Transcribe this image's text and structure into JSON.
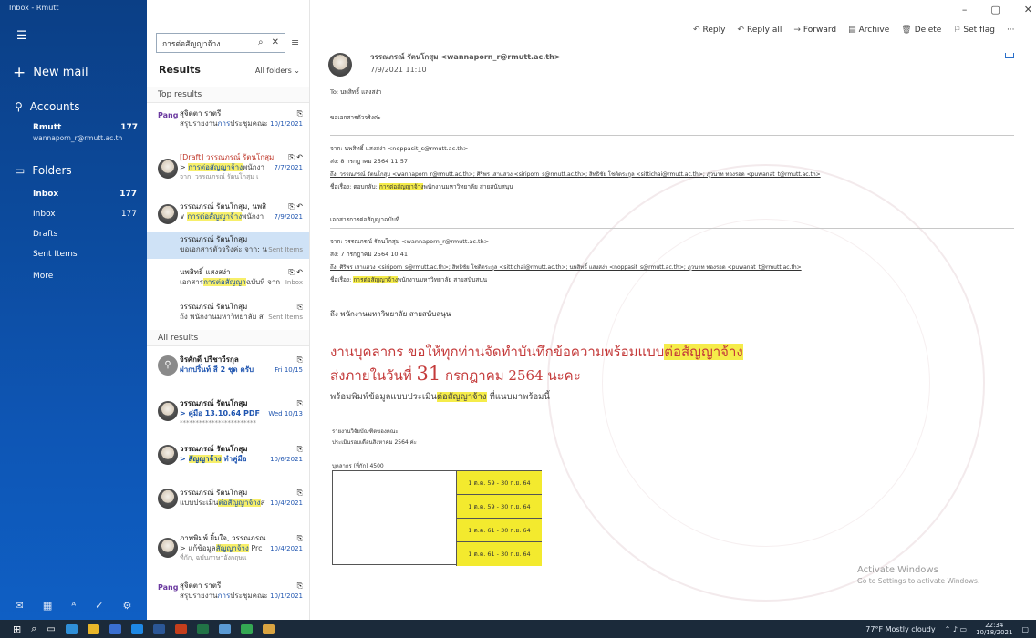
{
  "window": {
    "title": "Inbox - Rmutt",
    "controls": [
      "–",
      "▢",
      "✕"
    ]
  },
  "nav": {
    "new_mail": "New mail",
    "accounts_label": "Accounts",
    "account": {
      "name": "Rmutt",
      "count": "177",
      "email": "wannaporn_r@rmutt.ac.th"
    },
    "folders_label": "Folders",
    "folders": [
      {
        "label": "Inbox",
        "count": "177"
      },
      {
        "label": "Inbox",
        "count": "177"
      },
      {
        "label": "Drafts",
        "count": ""
      },
      {
        "label": "Sent Items",
        "count": ""
      },
      {
        "label": "More",
        "count": ""
      }
    ],
    "bottom_icons": [
      "mail-icon",
      "calendar-icon",
      "people-icon",
      "todo-icon",
      "settings-icon"
    ]
  },
  "search": {
    "query": "การต่อสัญญาจ้าง",
    "results_label": "Results",
    "scope": "All folders"
  },
  "list": {
    "top_results": "Top results",
    "all_results": "All results",
    "items": [
      {
        "sender": "สุจิตตา ราตรี",
        "subject_pre": "สรุปรายงาน",
        "subject_hl": "การ",
        "subject_post": "ประชุมคณะ",
        "date": "10/1/2021",
        "preview": ""
      },
      {
        "sender": "[Draft] วรรณภรณ์ รัตนโกสุม",
        "subject_pre": "> ",
        "subject_hl": "การต่อสัญญาจ้าง",
        "subject_post": "พนักงา",
        "date": "7/7/2021",
        "preview": "จาก: วรรณภรณ์ รัตนโกสุม เ"
      },
      {
        "sender": "วรรณภรณ์ รัตนโกสุม, นพสิ",
        "subject_pre": "∨ ",
        "subject_hl": "การต่อสัญญาจ้าง",
        "subject_post": "พนักงา",
        "date": "7/9/2021",
        "preview": ""
      },
      {
        "sender": "วรรณภรณ์ รัตนโกสุม",
        "subject_pre": "ขอเอกสารตัวจริงค่ะ จาก: น",
        "subject_hl": "",
        "subject_post": "",
        "date": "Sent Items",
        "preview": ""
      },
      {
        "sender": "นพสิทธิ์ แสงสง่า",
        "subject_pre": "เอกสาร",
        "subject_hl": "การต่อสัญญา",
        "subject_post": "ฉบับที่ จาก",
        "date": "Inbox",
        "preview": ""
      },
      {
        "sender": "วรรณภรณ์ รัตนโกสุม",
        "subject_pre": "ถึง พนักงานมหาวิทยาลัย ส",
        "subject_hl": "",
        "subject_post": "",
        "date": "Sent Items",
        "preview": ""
      },
      {
        "sender": "จิรศักดิ์ ปรีชาวีรกุล",
        "subject_pre": "ฝากปริ้นท์ สี 2 ชุด ครับ",
        "subject_hl": "",
        "subject_post": "",
        "date": "Fri 10/15",
        "preview": ""
      },
      {
        "sender": "วรรณภรณ์ รัตนโกสุม",
        "subject_pre": "> คู่มือ 13.10.64 PDF",
        "subject_hl": "",
        "subject_post": "",
        "date": "Wed 10/13",
        "preview": "************************"
      },
      {
        "sender": "วรรณภรณ์ รัตนโกสุม",
        "subject_pre": "> ",
        "subject_hl": "สัญญาจ้าง",
        "subject_post": " ทำคู่มือ",
        "date": "10/6/2021",
        "preview": ""
      },
      {
        "sender": "วรรณภรณ์ รัตนโกสุม",
        "subject_pre": "แบบประเมิน",
        "subject_hl": "ต่อสัญญาจ้าง",
        "subject_post": "ส",
        "date": "10/4/2021",
        "preview": ""
      },
      {
        "sender": "ภาพพิมพ์ ยิ้มใจ, วรรณภรณ",
        "subject_pre": "> แก้ข้อมูล",
        "subject_hl": "สัญญาจ้าง",
        "subject_post": " Prc",
        "date": "10/4/2021",
        "preview": "ที่กัก, ฉบับภาษาอังกฤษแ"
      },
      {
        "sender": "สุจิตตา ราตรี",
        "subject_pre": "สรุปรายงาน",
        "subject_hl": "การ",
        "subject_post": "ประชุมคณะ",
        "date": "10/1/2021",
        "preview": ""
      }
    ]
  },
  "toolbar": {
    "reply": "Reply",
    "reply_all": "Reply all",
    "forward": "Forward",
    "archive": "Archive",
    "delete": "Delete",
    "set_flag": "Set flag",
    "more": "···"
  },
  "message": {
    "from": "วรรณภรณ์ รัตนโกสุม <wannaporn_r@rmutt.ac.th>",
    "date": "7/9/2021 11:10",
    "to": "To: นพสิทธิ์ แสงสง่า",
    "l1": "ขอเอกสารตัวจริงค่ะ",
    "l2": "จาก: นพสิทธิ์ แสงสง่า <noppasit_s@rmutt.ac.th>",
    "l3": "ส่ง: 8 กรกฎาคม 2564 11:57",
    "l4": "ถึง: วรรณภรณ์ รัตนโกสุม <wannaporn_r@rmutt.ac.th>; ศิริพร เสาแสวง <siriporn_s@rmutt.ac.th>; สิทธิชัย โชติตระกูล <sittichai@rmutt.ac.th>; ภูวนาท ทองรอด <puwanat_t@rmutt.ac.th>",
    "l5_pre": "ชื่อเรื่อง: ตอบกลับ: ",
    "l5_hl": "การต่อสัญญาจ้าง",
    "l5_post": "พนักงานมหาวิทยาลัย สายสนับสนุน",
    "l6": "เอกสารการต่อสัญญาฉบับที่",
    "l7": "จาก: วรรณภรณ์ รัตนโกสุม <wannaporn_r@rmutt.ac.th>",
    "l8": "ส่ง: 7 กรกฎาคม 2564 10:41",
    "l9": "ถึง: ศิริพร เสาแสวง <siriporn_s@rmutt.ac.th>; สิทธิชัย โชติตระกูล <sittichai@rmutt.ac.th>; นพสิทธิ์ แสงสง่า <noppasit_s@rmutt.ac.th>; ภูวนาท ทองรอด <puwanat_t@rmutt.ac.th>",
    "l10_pre": "ชื่อเรื่อง: ",
    "l10_hl": "การต่อสัญญาจ้าง",
    "l10_post": "พนักงานมหาวิทยาลัย สายสนับสนุน",
    "l11": "ถึง พนักงานมหาวิทยาลัย สายสนับสนุน",
    "big1_pre": "งานบุคลากร ขอให้ทุกท่านจัดทำบันทึกข้อความพร้อมแบบ",
    "big1_hl": "ต่อสัญญาจ้าง",
    "big2_pre": "ส่งภายในวันที่ ",
    "big2_num": "31",
    "big2_post": " กรกฎาคม 2564 นะคะ",
    "small_pre": "พร้อมพิมพ์ข้อมูลแบบประเมิน",
    "small_hl": "ต่อสัญญาจ้าง",
    "small_post": " ที่แนบมาพร้อมนี้",
    "note1": "รายงานวิจัยบัณฑิตของคณะ",
    "note2": "ประเมินรอบเดือนสิงหาคม 2564 ค่ะ",
    "note3": "บุคลากร (ที่กัก) 4500",
    "table_rows": [
      "1 ต.ค. 59 - 30 ก.ย. 64",
      "1 ต.ค. 59 - 30 ก.ย. 64",
      "1 ต.ค. 61 - 30 ก.ย. 64",
      "1 ต.ค. 61 - 30 ก.ย. 64"
    ]
  },
  "activate": {
    "title": "Activate Windows",
    "sub": "Go to Settings to activate Windows."
  },
  "taskbar": {
    "weather": "77°F  Mostly cloudy",
    "time": "22:34",
    "date": "10/18/2021"
  }
}
